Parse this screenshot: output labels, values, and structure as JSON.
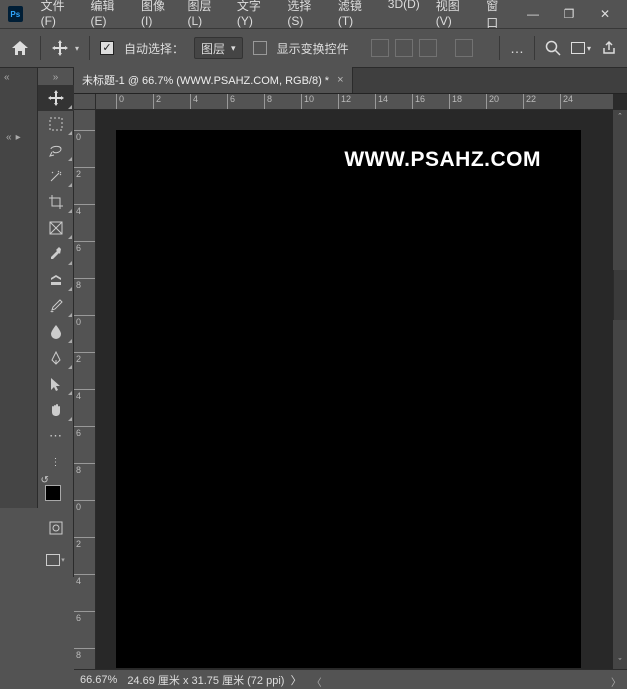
{
  "app": {
    "logo": "Ps"
  },
  "menu": {
    "items": [
      "文件(F)",
      "编辑(E)",
      "图像(I)",
      "图层(L)",
      "文字(Y)",
      "选择(S)",
      "滤镜(T)",
      "3D(D)",
      "视图(V)",
      "窗口"
    ]
  },
  "window_controls": {
    "min": "—",
    "max": "❐",
    "close": "✕"
  },
  "options": {
    "auto_select": "自动选择：",
    "layer_dd": "图层",
    "show_transform": "显示变换控件",
    "more": "…"
  },
  "document": {
    "tab_title": "未标题-1 @ 66.7% (WWW.PSAHZ.COM, RGB/8) *",
    "watermark": "WWW.PSAHZ.COM"
  },
  "ruler_h": [
    "0",
    "2",
    "4",
    "6",
    "8",
    "10",
    "12",
    "14",
    "16",
    "18",
    "20",
    "22",
    "24"
  ],
  "ruler_v": [
    "0",
    "2",
    "4",
    "6",
    "8",
    "0",
    "2",
    "4",
    "6",
    "8",
    "0",
    "2",
    "4",
    "6",
    "8"
  ],
  "status": {
    "zoom": "66.67%",
    "dims": "24.69 厘米 x 31.75 厘米 (72 ppi)"
  }
}
